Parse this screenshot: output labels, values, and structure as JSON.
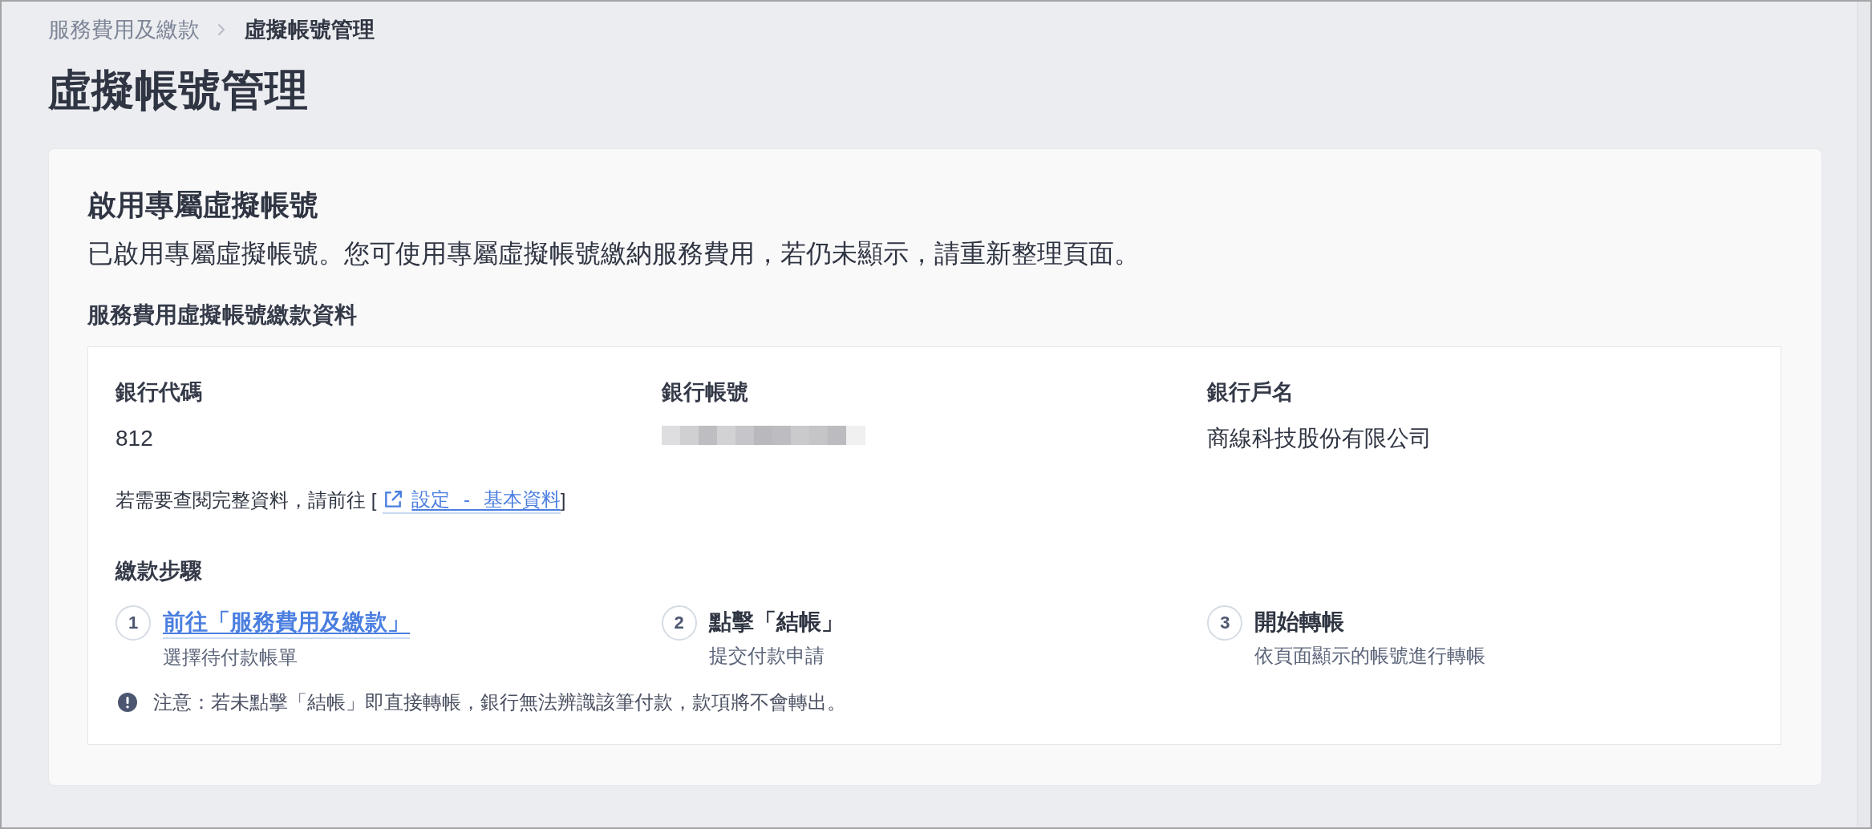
{
  "breadcrumb": [
    {
      "label": "服務費用及繳款",
      "current": false
    },
    {
      "label": "虛擬帳號管理",
      "current": true
    }
  ],
  "page_title": "虛擬帳號管理",
  "card": {
    "title": "啟用專屬虛擬帳號",
    "description": "已啟用專屬虛擬帳號。您可使用專屬虛擬帳號繳納服務費用，若仍未顯示，請重新整理頁面。",
    "section_title": "服務費用虛擬帳號繳款資料",
    "fields": [
      {
        "label": "銀行代碼",
        "value": "812",
        "redacted": false
      },
      {
        "label": "銀行帳號",
        "redacted": true
      },
      {
        "label": "銀行戶名",
        "value": "商線科技股份有限公司",
        "redacted": false
      }
    ],
    "settings_hint": {
      "text_before": "若需要查閱完整資料，請前往 [",
      "link": "設定 - 基本資料",
      "text_after": "]"
    },
    "steps_title": "繳款步驟",
    "steps": [
      {
        "number": "1",
        "kind": "link",
        "title": "前往「服務費用及繳款」",
        "description": "選擇待付款帳單"
      },
      {
        "number": "2",
        "kind": "text",
        "title": "點擊「結帳」",
        "description": "提交付款申請"
      },
      {
        "number": "3",
        "kind": "text",
        "title": "開始轉帳",
        "description": "依頁面顯示的帳號進行轉帳"
      }
    ],
    "warning": "注意：若未點擊「結帳」即直接轉帳，銀行無法辨識該筆付款，款項將不會轉出。"
  }
}
